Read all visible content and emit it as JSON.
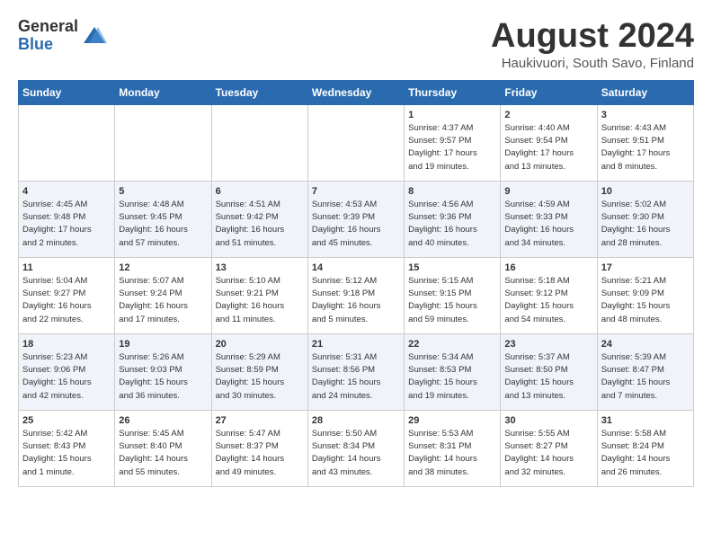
{
  "logo": {
    "general": "General",
    "blue": "Blue"
  },
  "title": "August 2024",
  "location": "Haukivuori, South Savo, Finland",
  "days_of_week": [
    "Sunday",
    "Monday",
    "Tuesday",
    "Wednesday",
    "Thursday",
    "Friday",
    "Saturday"
  ],
  "weeks": [
    [
      {
        "day": "",
        "info": ""
      },
      {
        "day": "",
        "info": ""
      },
      {
        "day": "",
        "info": ""
      },
      {
        "day": "",
        "info": ""
      },
      {
        "day": "1",
        "info": "Sunrise: 4:37 AM\nSunset: 9:57 PM\nDaylight: 17 hours\nand 19 minutes."
      },
      {
        "day": "2",
        "info": "Sunrise: 4:40 AM\nSunset: 9:54 PM\nDaylight: 17 hours\nand 13 minutes."
      },
      {
        "day": "3",
        "info": "Sunrise: 4:43 AM\nSunset: 9:51 PM\nDaylight: 17 hours\nand 8 minutes."
      }
    ],
    [
      {
        "day": "4",
        "info": "Sunrise: 4:45 AM\nSunset: 9:48 PM\nDaylight: 17 hours\nand 2 minutes."
      },
      {
        "day": "5",
        "info": "Sunrise: 4:48 AM\nSunset: 9:45 PM\nDaylight: 16 hours\nand 57 minutes."
      },
      {
        "day": "6",
        "info": "Sunrise: 4:51 AM\nSunset: 9:42 PM\nDaylight: 16 hours\nand 51 minutes."
      },
      {
        "day": "7",
        "info": "Sunrise: 4:53 AM\nSunset: 9:39 PM\nDaylight: 16 hours\nand 45 minutes."
      },
      {
        "day": "8",
        "info": "Sunrise: 4:56 AM\nSunset: 9:36 PM\nDaylight: 16 hours\nand 40 minutes."
      },
      {
        "day": "9",
        "info": "Sunrise: 4:59 AM\nSunset: 9:33 PM\nDaylight: 16 hours\nand 34 minutes."
      },
      {
        "day": "10",
        "info": "Sunrise: 5:02 AM\nSunset: 9:30 PM\nDaylight: 16 hours\nand 28 minutes."
      }
    ],
    [
      {
        "day": "11",
        "info": "Sunrise: 5:04 AM\nSunset: 9:27 PM\nDaylight: 16 hours\nand 22 minutes."
      },
      {
        "day": "12",
        "info": "Sunrise: 5:07 AM\nSunset: 9:24 PM\nDaylight: 16 hours\nand 17 minutes."
      },
      {
        "day": "13",
        "info": "Sunrise: 5:10 AM\nSunset: 9:21 PM\nDaylight: 16 hours\nand 11 minutes."
      },
      {
        "day": "14",
        "info": "Sunrise: 5:12 AM\nSunset: 9:18 PM\nDaylight: 16 hours\nand 5 minutes."
      },
      {
        "day": "15",
        "info": "Sunrise: 5:15 AM\nSunset: 9:15 PM\nDaylight: 15 hours\nand 59 minutes."
      },
      {
        "day": "16",
        "info": "Sunrise: 5:18 AM\nSunset: 9:12 PM\nDaylight: 15 hours\nand 54 minutes."
      },
      {
        "day": "17",
        "info": "Sunrise: 5:21 AM\nSunset: 9:09 PM\nDaylight: 15 hours\nand 48 minutes."
      }
    ],
    [
      {
        "day": "18",
        "info": "Sunrise: 5:23 AM\nSunset: 9:06 PM\nDaylight: 15 hours\nand 42 minutes."
      },
      {
        "day": "19",
        "info": "Sunrise: 5:26 AM\nSunset: 9:03 PM\nDaylight: 15 hours\nand 36 minutes."
      },
      {
        "day": "20",
        "info": "Sunrise: 5:29 AM\nSunset: 8:59 PM\nDaylight: 15 hours\nand 30 minutes."
      },
      {
        "day": "21",
        "info": "Sunrise: 5:31 AM\nSunset: 8:56 PM\nDaylight: 15 hours\nand 24 minutes."
      },
      {
        "day": "22",
        "info": "Sunrise: 5:34 AM\nSunset: 8:53 PM\nDaylight: 15 hours\nand 19 minutes."
      },
      {
        "day": "23",
        "info": "Sunrise: 5:37 AM\nSunset: 8:50 PM\nDaylight: 15 hours\nand 13 minutes."
      },
      {
        "day": "24",
        "info": "Sunrise: 5:39 AM\nSunset: 8:47 PM\nDaylight: 15 hours\nand 7 minutes."
      }
    ],
    [
      {
        "day": "25",
        "info": "Sunrise: 5:42 AM\nSunset: 8:43 PM\nDaylight: 15 hours\nand 1 minute."
      },
      {
        "day": "26",
        "info": "Sunrise: 5:45 AM\nSunset: 8:40 PM\nDaylight: 14 hours\nand 55 minutes."
      },
      {
        "day": "27",
        "info": "Sunrise: 5:47 AM\nSunset: 8:37 PM\nDaylight: 14 hours\nand 49 minutes."
      },
      {
        "day": "28",
        "info": "Sunrise: 5:50 AM\nSunset: 8:34 PM\nDaylight: 14 hours\nand 43 minutes."
      },
      {
        "day": "29",
        "info": "Sunrise: 5:53 AM\nSunset: 8:31 PM\nDaylight: 14 hours\nand 38 minutes."
      },
      {
        "day": "30",
        "info": "Sunrise: 5:55 AM\nSunset: 8:27 PM\nDaylight: 14 hours\nand 32 minutes."
      },
      {
        "day": "31",
        "info": "Sunrise: 5:58 AM\nSunset: 8:24 PM\nDaylight: 14 hours\nand 26 minutes."
      }
    ]
  ]
}
